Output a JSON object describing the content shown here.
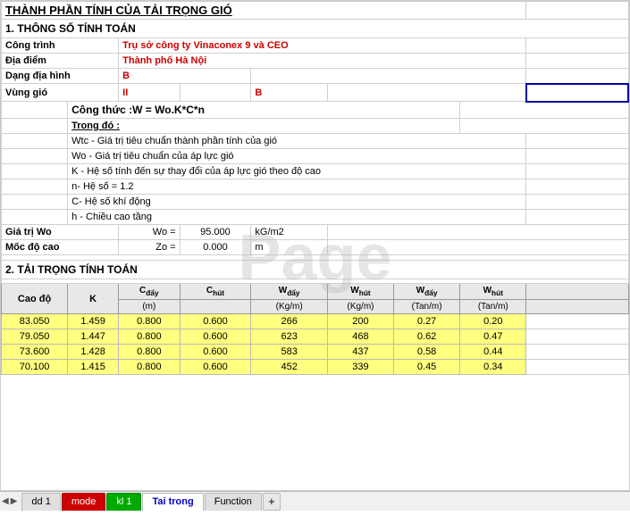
{
  "title": "THÀNH PHẦN TÍNH CỦA TẢI TRỌNG GIÓ",
  "section1": {
    "header": "1. THÔNG SỐ TÍNH TOÁN",
    "cong_trinh_label": "Công trình",
    "cong_trinh_value": "Trụ sở công ty Vinaconex 9 và CEO",
    "dia_diem_label": "Địa điểm",
    "dia_diem_value": "Thành phố  Hà Nội",
    "dang_dia_hinh_label": "Dạng địa hình",
    "dang_dia_hinh_value": "B",
    "vung_gio_label": "Vùng gió",
    "vung_gio_value1": "II",
    "vung_gio_value2": "B",
    "formula_label": "Công thức :W = Wo.K*C*n",
    "trong_do_label": "Trong đó :",
    "wtc_desc": "Wtc - Giá trị tiêu chuẩn thành phần tính của gió",
    "wo_desc": "Wo - Giá trị tiêu chuẩn của áp lực gió",
    "k_desc": "K - Hệ số tính đến sự thay đổi của áp lực gió theo độ cao",
    "n_desc": "n- Hệ số = 1.2",
    "c_desc": "C- Hệ số khí động",
    "h_desc": "h - Chiều cao tầng",
    "gia_tri_wo_label": "Giá trị Wo",
    "wo_eq": "Wo =",
    "wo_val": "95.000",
    "wo_unit": "kG/m2",
    "moc_do_cao_label": "Mốc độ cao",
    "zo_eq": "Zo =",
    "zo_val": "0.000",
    "zo_unit": "m"
  },
  "section2": {
    "header": "2. TẢI TRỌNG TÍNH TOÁN",
    "columns": [
      "Cao độ",
      "K",
      "C_đẩy",
      "C_hút",
      "W_đẩy",
      "W_hút",
      "W_đẩy",
      "W_hút"
    ],
    "col_units": [
      "(m)",
      "",
      "",
      "",
      "(Kg/m)",
      "(Kg/m)",
      "(Tan/m)",
      "(Tan/m)"
    ],
    "rows": [
      {
        "cao_do": "83.050",
        "k": "1.459",
        "c_day": "0.800",
        "c_hut": "0.600",
        "w_day_kg": "266",
        "w_hut_kg": "200",
        "w_day_tan": "0.27",
        "w_hut_tan": "0.20"
      },
      {
        "cao_do": "79.050",
        "k": "1.447",
        "c_day": "0.800",
        "c_hut": "0.600",
        "w_day_kg": "623",
        "w_hut_kg": "468",
        "w_day_tan": "0.62",
        "w_hut_tan": "0.47"
      },
      {
        "cao_do": "73.600",
        "k": "1.428",
        "c_day": "0.800",
        "c_hut": "0.600",
        "w_day_kg": "583",
        "w_hut_kg": "437",
        "w_day_tan": "0.58",
        "w_hut_tan": "0.44"
      },
      {
        "cao_do": "70.100",
        "k": "1.415",
        "c_day": "0.800",
        "c_hut": "0.600",
        "w_day_kg": "452",
        "w_hut_kg": "339",
        "w_day_tan": "0.45",
        "w_hut_tan": "0.34"
      }
    ]
  },
  "tabs": [
    {
      "label": "dd 1",
      "type": "normal"
    },
    {
      "label": "mode",
      "type": "red"
    },
    {
      "label": "kl 1",
      "type": "green"
    },
    {
      "label": "Tai trong",
      "type": "blue-active"
    },
    {
      "label": "Function",
      "type": "normal"
    }
  ],
  "watermark": "Page",
  "plus_icon": "+"
}
